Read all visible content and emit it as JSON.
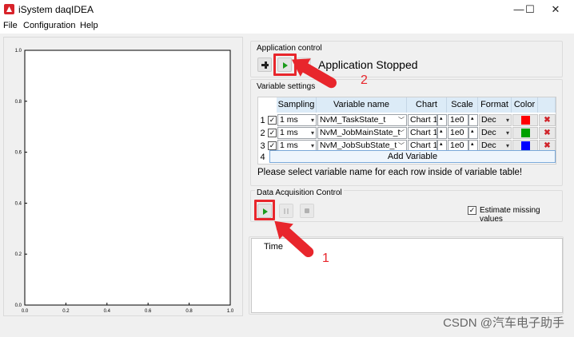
{
  "window": {
    "title": "iSystem daqIDEA",
    "buttons": [
      "—",
      "☐",
      "✕"
    ]
  },
  "menu": [
    "File",
    "Configuration",
    "Help"
  ],
  "plot": {
    "yticks": [
      "1.0",
      "0.8",
      "0.6",
      "0.4",
      "0.2",
      "0.0"
    ],
    "xticks": [
      "0.0",
      "0.2",
      "0.4",
      "0.6",
      "0.8",
      "1.0"
    ]
  },
  "app_control": {
    "title": "Application control",
    "status": "Application Stopped",
    "annotation": "2"
  },
  "var_settings": {
    "title": "Variable settings",
    "headers": [
      "Sampling",
      "Variable name",
      "Chart",
      "Scale",
      "Format",
      "Color"
    ],
    "rows": [
      {
        "num": "1",
        "checked": "✓",
        "sampling": "1 ms",
        "name": "NvM_TaskState_t",
        "chart": "Chart 1",
        "scale": "1e0",
        "format": "Dec",
        "color": "#ff0000"
      },
      {
        "num": "2",
        "checked": "✓",
        "sampling": "1 ms",
        "name": "NvM_JobMainState_t",
        "chart": "Chart 1",
        "scale": "1e0",
        "format": "Dec",
        "color": "#00a000"
      },
      {
        "num": "3",
        "checked": "✓",
        "sampling": "1 ms",
        "name": "NvM_JobSubState_t",
        "chart": "Chart 1",
        "scale": "1e0",
        "format": "Dec",
        "color": "#0000ff"
      }
    ],
    "add_row_num": "4",
    "add_label": "Add Variable",
    "hint": "Please select variable name for each row inside of variable table!"
  },
  "daq_control": {
    "title": "Data Acquisition Control",
    "estimate_label": "Estimate missing values",
    "estimate_checked": "✓",
    "annotation": "1"
  },
  "time_panel": {
    "header": "Time"
  },
  "watermark": "CSDN @汽车电子助手"
}
